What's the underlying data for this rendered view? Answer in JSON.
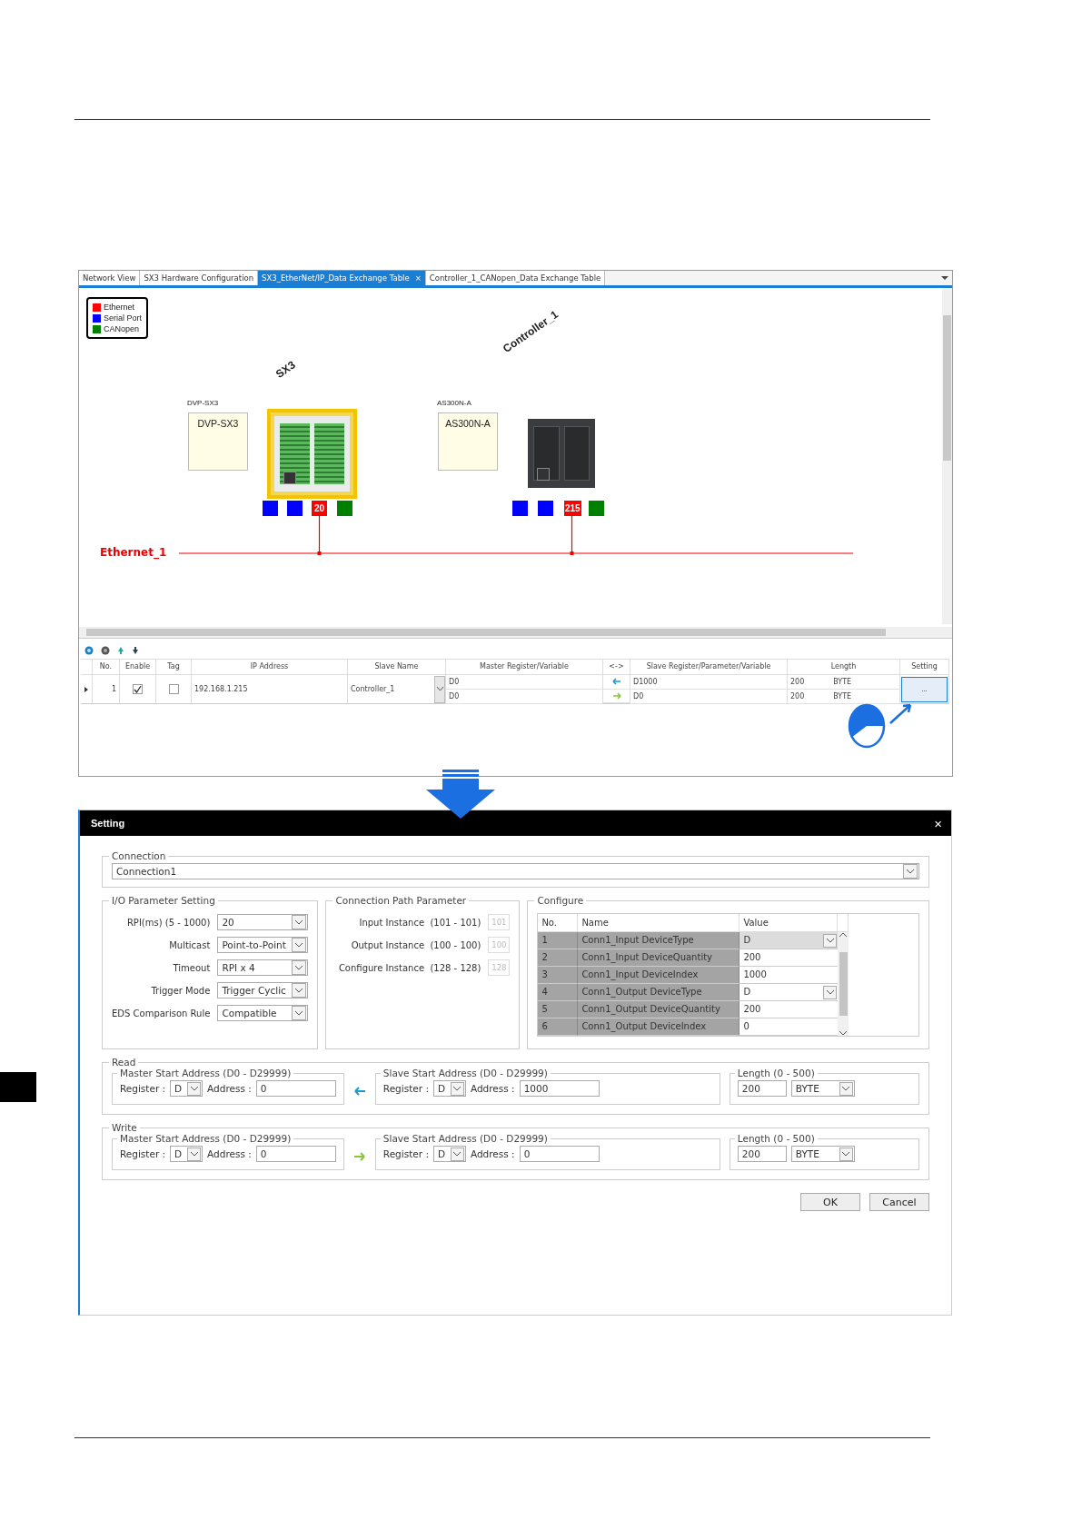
{
  "tabs": [
    {
      "label": "Network View",
      "selected": false
    },
    {
      "label": "SX3 Hardware Configuration",
      "selected": false
    },
    {
      "label": "SX3_EtherNet/IP_Data Exchange Table",
      "selected": true,
      "close": "×"
    },
    {
      "label": "Controller_1_CANopen_Data Exchange Table",
      "selected": false
    }
  ],
  "legend": [
    {
      "label": "Ethernet",
      "color": "#ff0000"
    },
    {
      "label": "Serial Port",
      "color": "#0000ff"
    },
    {
      "label": "CANopen",
      "color": "#008000"
    }
  ],
  "devices": [
    {
      "name": "SX3",
      "model": "DVP-SX3",
      "box_label": "DVP-SX3",
      "selected": true,
      "ports": [
        {
          "color": "#0000ff"
        },
        {
          "color": "#0000ff"
        },
        {
          "color": "#ff0000",
          "label": "20"
        },
        {
          "color": "#008000"
        }
      ]
    },
    {
      "name": "Controller_1",
      "model": "AS300N-A",
      "box_label": "AS300N-A",
      "selected": false,
      "ports": [
        {
          "color": "#0000ff"
        },
        {
          "color": "#0000ff"
        },
        {
          "color": "#ff0000",
          "label": "215"
        },
        {
          "color": "#008000"
        }
      ]
    }
  ],
  "network": {
    "label": "Ethernet_1"
  },
  "table": {
    "columns": [
      "No.",
      "Enable",
      "Tag",
      "IP Address",
      "Slave Name",
      "Master Register/Variable",
      "<->",
      "Slave Register/Parameter/Variable",
      "Length",
      "Setting"
    ],
    "rows": [
      {
        "no": "1",
        "enable": true,
        "tag": false,
        "ip": "192.168.1.215",
        "slave": "Controller_1",
        "setting": "...",
        "mappings": [
          {
            "master": "D0",
            "kind": "read",
            "slave": "D1000",
            "length": "200",
            "unit": "BYTE"
          },
          {
            "master": "D0",
            "kind": "write",
            "slave": "D0",
            "length": "200",
            "unit": "BYTE"
          }
        ]
      }
    ]
  },
  "dialog": {
    "title": "Setting",
    "close": "×",
    "connection": {
      "label": "Connection",
      "value": "Connection1"
    },
    "io": {
      "label": "I/O Parameter Setting",
      "fields": [
        {
          "label": "RPI(ms) (5 - 1000)",
          "value": "20"
        },
        {
          "label": "Multicast",
          "value": "Point-to-Point"
        },
        {
          "label": "Timeout",
          "value": "RPI x 4"
        },
        {
          "label": "Trigger Mode",
          "value": "Trigger Cyclic"
        },
        {
          "label": "EDS Comparison Rule",
          "value": "Compatible"
        }
      ]
    },
    "path": {
      "label": "Connection Path Parameter",
      "fields": [
        {
          "label": "Input Instance  (101 - 101)",
          "value": "101",
          "disabled": true
        },
        {
          "label": "Output Instance  (100 - 100)",
          "value": "100",
          "disabled": true
        },
        {
          "label": "Configure Instance  (128 - 128)",
          "value": "128",
          "disabled": true
        }
      ]
    },
    "configure": {
      "label": "Configure",
      "columns": [
        "No.",
        "Name",
        "Value"
      ],
      "rows": [
        {
          "no": "1",
          "name": "Conn1_Input DeviceType",
          "value": "D",
          "kind": "dropdown",
          "selected": true
        },
        {
          "no": "2",
          "name": "Conn1_Input DeviceQuantity",
          "value": "200",
          "kind": "text",
          "selected": false
        },
        {
          "no": "3",
          "name": "Conn1_Input DeviceIndex",
          "value": "1000",
          "kind": "text",
          "selected": false
        },
        {
          "no": "4",
          "name": "Conn1_Output DeviceType",
          "value": "D",
          "kind": "dropdown",
          "selected": false
        },
        {
          "no": "5",
          "name": "Conn1_Output DeviceQuantity",
          "value": "200",
          "kind": "text",
          "selected": false
        },
        {
          "no": "6",
          "name": "Conn1_Output DeviceIndex",
          "value": "0",
          "kind": "text",
          "selected": false
        }
      ]
    },
    "transfers": [
      {
        "label": "Read",
        "kind": "read",
        "master": {
          "label": "Master Start Address  (D0 - D29999)",
          "register_label": "Register :",
          "register": "D",
          "address_label": "Address :",
          "address": "0"
        },
        "slave": {
          "label": "Slave Start Address  (D0 - D29999)",
          "register_label": "Register :",
          "register": "D",
          "address_label": "Address :",
          "address": "1000"
        },
        "length": {
          "label": "Length  (0 - 500)",
          "value": "200",
          "unit": "BYTE"
        }
      },
      {
        "label": "Write",
        "kind": "write",
        "master": {
          "label": "Master Start Address  (D0 - D29999)",
          "register_label": "Register :",
          "register": "D",
          "address_label": "Address :",
          "address": "0"
        },
        "slave": {
          "label": "Slave Start Address  (D0 - D29999)",
          "register_label": "Register :",
          "register": "D",
          "address_label": "Address :",
          "address": "0"
        },
        "length": {
          "label": "Length  (0 - 500)",
          "value": "200",
          "unit": "BYTE"
        }
      }
    ],
    "buttons": [
      "OK",
      "Cancel"
    ]
  }
}
